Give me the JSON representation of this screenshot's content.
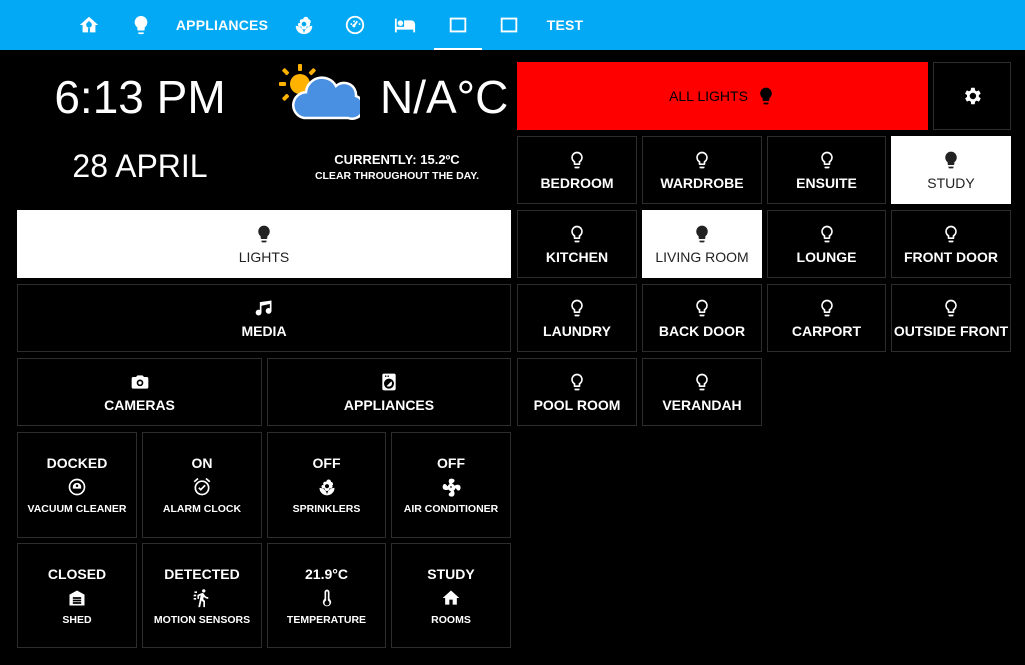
{
  "tabs": [
    {
      "id": "home",
      "icon": "home-icon"
    },
    {
      "id": "lights",
      "icon": "lightbulb-icon"
    },
    {
      "id": "appliances",
      "label": "APPLIANCES"
    },
    {
      "id": "garden",
      "icon": "flower-icon"
    },
    {
      "id": "dashboard",
      "icon": "gauge-icon"
    },
    {
      "id": "bedroom",
      "icon": "bed-icon"
    },
    {
      "id": "panel1",
      "icon": "square-icon",
      "active": true
    },
    {
      "id": "panel2",
      "icon": "square-icon"
    },
    {
      "id": "test",
      "label": "TEST"
    }
  ],
  "clock": {
    "time": "6:13 PM",
    "date": "28 APRIL"
  },
  "weather": {
    "temperature": "N/A°C",
    "current": "CURRENTLY: 15.2ºC",
    "forecast": "CLEAR THROUGHOUT THE DAY.",
    "icon": "partly-cloudy-icon"
  },
  "main_tiles": {
    "lights": "LIGHTS",
    "media": "MEDIA",
    "cameras": "CAMERAS",
    "appliances": "APPLIANCES"
  },
  "sensors": [
    {
      "state": "DOCKED",
      "name": "VACUUM CLEANER",
      "icon": "robot-vacuum-icon"
    },
    {
      "state": "ON",
      "name": "ALARM CLOCK",
      "icon": "alarm-clock-icon"
    },
    {
      "state": "OFF",
      "name": "SPRINKLERS",
      "icon": "flower-icon"
    },
    {
      "state": "OFF",
      "name": "AIR CONDITIONER",
      "icon": "fan-icon"
    },
    {
      "state": "CLOSED",
      "name": "SHED",
      "icon": "garage-icon"
    },
    {
      "state": "DETECTED",
      "name": "MOTION SENSORS",
      "icon": "motion-icon"
    },
    {
      "state": "21.9°C",
      "name": "TEMPERATURE",
      "icon": "thermometer-icon"
    },
    {
      "state": "STUDY",
      "name": "ROOMS",
      "icon": "house-icon"
    }
  ],
  "all_lights": {
    "label": "ALL LIGHTS",
    "color": "#ff0000"
  },
  "rooms": [
    {
      "name": "BEDROOM",
      "on": false
    },
    {
      "name": "WARDROBE",
      "on": false
    },
    {
      "name": "ENSUITE",
      "on": false
    },
    {
      "name": "STUDY",
      "on": true
    },
    {
      "name": "KITCHEN",
      "on": false
    },
    {
      "name": "LIVING ROOM",
      "on": true
    },
    {
      "name": "LOUNGE",
      "on": false
    },
    {
      "name": "FRONT DOOR",
      "on": false
    },
    {
      "name": "LAUNDRY",
      "on": false
    },
    {
      "name": "BACK DOOR",
      "on": false
    },
    {
      "name": "CARPORT",
      "on": false
    },
    {
      "name": "OUTSIDE FRONT",
      "on": false
    },
    {
      "name": "POOL ROOM",
      "on": false
    },
    {
      "name": "VERANDAH",
      "on": false
    }
  ],
  "colors": {
    "topbar": "#03a9f4",
    "background": "#000000",
    "tile_on": "#ffffff",
    "accent_red": "#ff0000"
  }
}
